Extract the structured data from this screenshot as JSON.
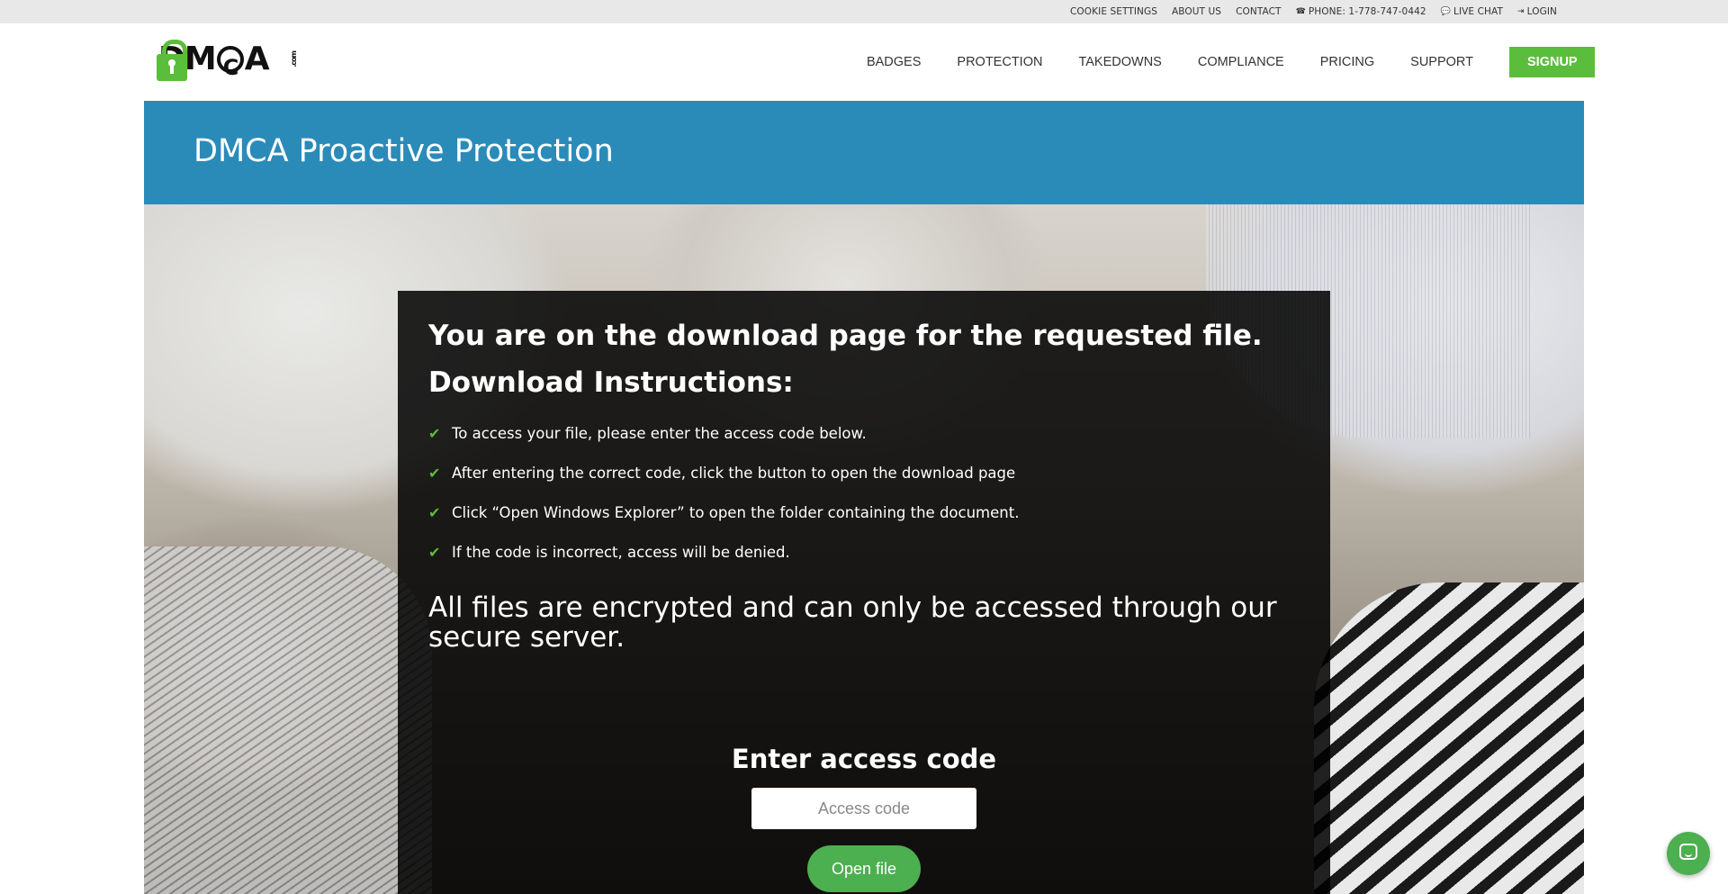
{
  "topbar": {
    "links": [
      {
        "label": "COOKIE SETTINGS",
        "icon": ""
      },
      {
        "label": "ABOUT US",
        "icon": ""
      },
      {
        "label": "CONTACT",
        "icon": ""
      },
      {
        "label": "PHONE: 1-778-747-0442",
        "icon": "phone-icon"
      },
      {
        "label": "LIVE CHAT",
        "icon": "chat-icon"
      },
      {
        "label": "LOGIN",
        "icon": "login-icon"
      }
    ]
  },
  "logo": {
    "text_left": "DM",
    "text_right": "A",
    "suffix": ".com"
  },
  "nav": {
    "items": [
      "BADGES",
      "PROTECTION",
      "TAKEDOWNS",
      "COMPLIANCE",
      "PRICING",
      "SUPPORT"
    ],
    "signup_label": "SIGNUP"
  },
  "banner": {
    "title": "DMCA Proactive Protection"
  },
  "content": {
    "title": "You are on the download page for the requested file.",
    "subtitle": "Download Instructions:",
    "instructions": [
      "To access your file, please enter the access code below.",
      "After entering the correct code, click the button to open the download page",
      "Click “Open Windows Explorer” to open the folder containing the document.",
      "If the code is incorrect, access will be denied."
    ],
    "note": "All files are encrypted and can only be accessed through our secure server.",
    "access_title": "Enter access code",
    "access_placeholder": "Access code",
    "open_button": "Open file"
  },
  "colors": {
    "brand_green": "#5bbd3c",
    "banner_blue": "#2a8bb9",
    "button_green": "#4caf50"
  }
}
